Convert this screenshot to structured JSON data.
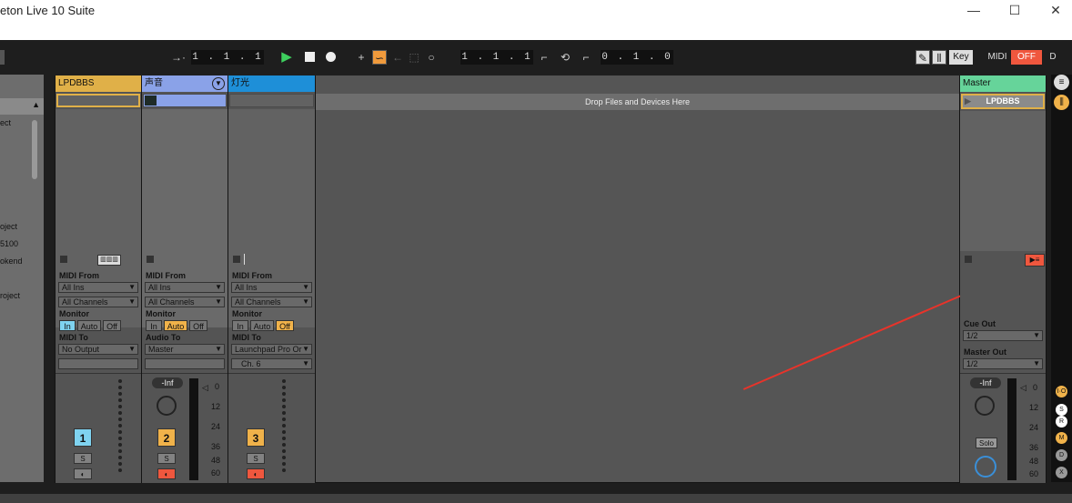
{
  "window": {
    "title": "eton Live 10 Suite",
    "min": "—",
    "max": "☐",
    "close": "✕"
  },
  "transport": {
    "arrangement_position": "1 . 1 . 1",
    "punch_in": "1 . 1 . 1",
    "loop_length": "0 . 1 . 0",
    "key_label": "Key",
    "midi_label": "MIDI",
    "off_label": "OFF",
    "d_label": "D"
  },
  "browser": {
    "items": [
      "ect",
      "oject",
      "5100",
      "okend",
      "roject"
    ]
  },
  "tracks": [
    {
      "name": "LPDBBS",
      "color": "#e0b048",
      "io_from_label": "MIDI From",
      "from": "All Ins",
      "channel": "All Channels",
      "monitor_label": "Monitor",
      "monitor": [
        "In",
        "Auto",
        "Off"
      ],
      "to_label": "MIDI To",
      "to": "No Output",
      "to2": "",
      "number": "1",
      "num_color": "#7fd3f0"
    },
    {
      "name": "声音",
      "color": "#8aa2e8",
      "io_from_label": "MIDI From",
      "from": "All Ins",
      "channel": "All Channels",
      "monitor_label": "Monitor",
      "monitor": [
        "In",
        "Auto",
        "Off"
      ],
      "to_label": "Audio To",
      "to": "Master",
      "to2": "",
      "number": "2",
      "num_color": "#f0b24a",
      "volume": "-Inf"
    },
    {
      "name": "灯光",
      "color": "#1e8fd8",
      "io_from_label": "MIDI From",
      "from": "All Ins",
      "channel": "All Channels",
      "monitor_label": "Monitor",
      "monitor": [
        "In",
        "Auto",
        "Off"
      ],
      "to_label": "MIDI To",
      "to": "Launchpad Pro Or",
      "to2": "Ch. 6",
      "number": "3",
      "num_color": "#f0b24a"
    }
  ],
  "drop_zone": {
    "text": "Drop Files and Devices Here"
  },
  "master": {
    "name": "Master",
    "clip": "LPDBBS",
    "cue_out_label": "Cue Out",
    "cue_out": "1/2",
    "master_out_label": "Master Out",
    "master_out": "1/2",
    "volume": "-Inf",
    "solo": "Solo",
    "color": "#66d49a"
  },
  "solo_label": "S",
  "meter_scale": [
    "0",
    "12",
    "24",
    "36",
    "48",
    "60"
  ],
  "side_buttons": [
    "I·O",
    "S",
    "R",
    "M",
    "D",
    "X"
  ]
}
